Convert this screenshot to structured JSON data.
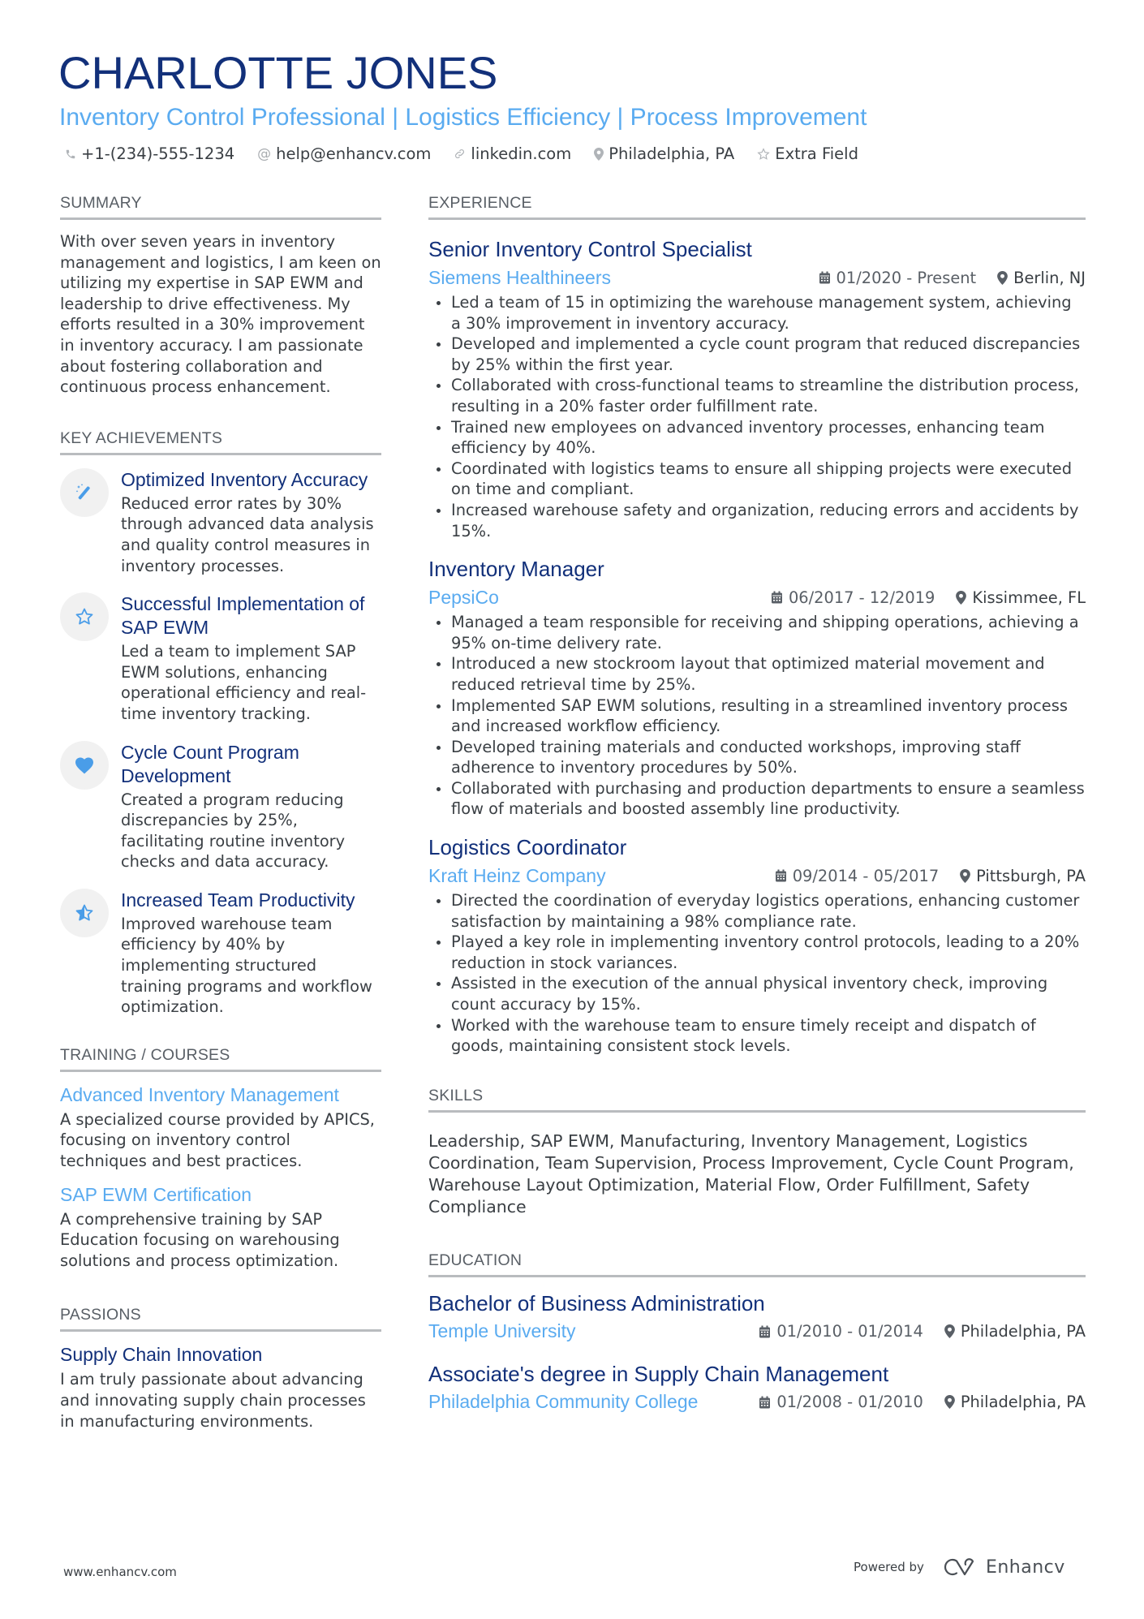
{
  "header": {
    "name": "CHARLOTTE JONES",
    "subtitle": "Inventory Control Professional | Logistics Efficiency | Process Improvement",
    "contacts": [
      {
        "icon": "phone-icon",
        "text": "+1-(234)-555-1234"
      },
      {
        "icon": "at-icon",
        "text": "help@enhancv.com"
      },
      {
        "icon": "link-icon",
        "text": "linkedin.com"
      },
      {
        "icon": "location-pin-icon",
        "text": "Philadelphia, PA"
      },
      {
        "icon": "star-outline-icon",
        "text": "Extra Field"
      }
    ]
  },
  "summary": {
    "title": "SUMMARY",
    "text": "With over seven years in inventory management and logistics, I am keen on utilizing my expertise in SAP EWM and leadership to drive effectiveness. My efforts resulted in a 30% improvement in inventory accuracy. I am passionate about fostering collaboration and continuous process enhancement."
  },
  "achievements": {
    "title": "KEY ACHIEVEMENTS",
    "items": [
      {
        "icon": "magic-wand-icon",
        "title": "Optimized Inventory Accuracy",
        "desc": "Reduced error rates by 30% through advanced data analysis and quality control measures in inventory processes."
      },
      {
        "icon": "star-outline-icon",
        "title": "Successful Implementation of SAP EWM",
        "desc": "Led a team to implement SAP EWM solutions, enhancing operational efficiency and real-time inventory tracking."
      },
      {
        "icon": "heart-icon",
        "title": "Cycle Count Program Development",
        "desc": "Created a program reducing discrepancies by 25%, facilitating routine inventory checks and data accuracy."
      },
      {
        "icon": "star-half-icon",
        "title": "Increased Team Productivity",
        "desc": "Improved warehouse team efficiency by 40% by implementing structured training programs and workflow optimization."
      }
    ]
  },
  "training": {
    "title": "TRAINING / COURSES",
    "items": [
      {
        "title": "Advanced Inventory Management",
        "desc": "A specialized course provided by APICS, focusing on inventory control techniques and best practices."
      },
      {
        "title": "SAP EWM Certification",
        "desc": "A comprehensive training by SAP Education focusing on warehousing solutions and process optimization."
      }
    ]
  },
  "passions": {
    "title": "PASSIONS",
    "items": [
      {
        "title": "Supply Chain Innovation",
        "desc": "I am truly passionate about advancing and innovating supply chain processes in manufacturing environments."
      }
    ]
  },
  "experience": {
    "title": "EXPERIENCE",
    "jobs": [
      {
        "title": "Senior Inventory Control Specialist",
        "company": "Siemens Healthineers",
        "dates": "01/2020 - Present",
        "location": "Berlin, NJ",
        "bullets": [
          "Led a team of 15 in optimizing the warehouse management system, achieving a 30% improvement in inventory accuracy.",
          "Developed and implemented a cycle count program that reduced discrepancies by 25% within the first year.",
          "Collaborated with cross-functional teams to streamline the distribution process, resulting in a 20% faster order fulfillment rate.",
          "Trained new employees on advanced inventory processes, enhancing team efficiency by 40%.",
          "Coordinated with logistics teams to ensure all shipping projects were executed on time and compliant.",
          "Increased warehouse safety and organization, reducing errors and accidents by 15%."
        ]
      },
      {
        "title": "Inventory Manager",
        "company": "PepsiCo",
        "dates": "06/2017 - 12/2019",
        "location": "Kissimmee, FL",
        "bullets": [
          "Managed a team responsible for receiving and shipping operations, achieving a 95% on-time delivery rate.",
          "Introduced a new stockroom layout that optimized material movement and reduced retrieval time by 25%.",
          "Implemented SAP EWM solutions, resulting in a streamlined inventory process and increased workflow efficiency.",
          "Developed training materials and conducted workshops, improving staff adherence to inventory procedures by 50%.",
          "Collaborated with purchasing and production departments to ensure a seamless flow of materials and boosted assembly line productivity."
        ]
      },
      {
        "title": "Logistics Coordinator",
        "company": "Kraft Heinz Company",
        "dates": "09/2014 - 05/2017",
        "location": "Pittsburgh, PA",
        "bullets": [
          "Directed the coordination of everyday logistics operations, enhancing customer satisfaction by maintaining a 98% compliance rate.",
          "Played a key role in implementing inventory control protocols, leading to a 20% reduction in stock variances.",
          "Assisted in the execution of the annual physical inventory check, improving count accuracy by 15%.",
          "Worked with the warehouse team to ensure timely receipt and dispatch of goods, maintaining consistent stock levels."
        ]
      }
    ]
  },
  "skills": {
    "title": "SKILLS",
    "text": "Leadership, SAP EWM, Manufacturing, Inventory Management, Logistics Coordination, Team Supervision, Process Improvement, Cycle Count Program, Warehouse Layout Optimization, Material Flow, Order Fulfillment, Safety Compliance"
  },
  "education": {
    "title": "EDUCATION",
    "items": [
      {
        "degree": "Bachelor of Business Administration",
        "school": "Temple University",
        "dates": "01/2010 - 01/2014",
        "location": "Philadelphia, PA"
      },
      {
        "degree": "Associate's degree in Supply Chain Management",
        "school": "Philadelphia Community College",
        "dates": "01/2008 - 01/2010",
        "location": "Philadelphia, PA"
      }
    ]
  },
  "footer": {
    "website": "www.enhancv.com",
    "powered_by": "Powered by",
    "brand": "Enhancv"
  },
  "colors": {
    "name": "#12307a",
    "accent": "#5aabf0",
    "text": "#3a3f44",
    "divider": "#b9bcbf",
    "icon_bg": "#f1f1f1"
  }
}
